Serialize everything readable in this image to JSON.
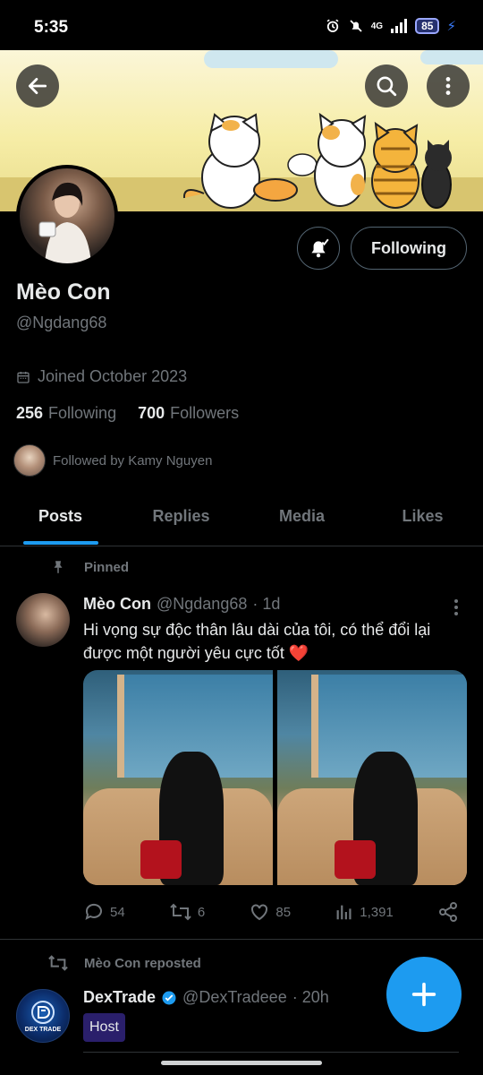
{
  "status_bar": {
    "time": "5:35",
    "network": "4G",
    "battery": "85"
  },
  "profile": {
    "display_name": "Mèo Con",
    "handle": "@Ngdang68",
    "joined": "Joined October 2023",
    "following_count": "256",
    "following_label": "Following",
    "followers_count": "700",
    "followers_label": "Followers",
    "followed_by": "Followed by Kamy Nguyen",
    "follow_button_label": "Following"
  },
  "tabs": [
    {
      "label": "Posts",
      "active": true
    },
    {
      "label": "Replies",
      "active": false
    },
    {
      "label": "Media",
      "active": false
    },
    {
      "label": "Likes",
      "active": false
    }
  ],
  "pinned_post": {
    "pinned_label": "Pinned",
    "author_name": "Mèo Con",
    "author_handle": "@Ngdang68",
    "time": "· 1d",
    "text": "Hi vọng sự độc thân lâu dài của tôi, có thể đổi lại được một người yêu cực tốt",
    "emoji": "❤️",
    "replies": "54",
    "reposts": "6",
    "likes": "85",
    "views": "1,391"
  },
  "repost": {
    "label": "Mèo Con reposted",
    "author_name": "DexTrade",
    "author_handle": "@DexTradeee",
    "time": "· 20h",
    "badge": "Host",
    "avatar_caption": "DEX TRADE"
  },
  "colors": {
    "accent": "#1d9bf0",
    "muted_text": "#71767b",
    "divider": "#2f3336"
  }
}
